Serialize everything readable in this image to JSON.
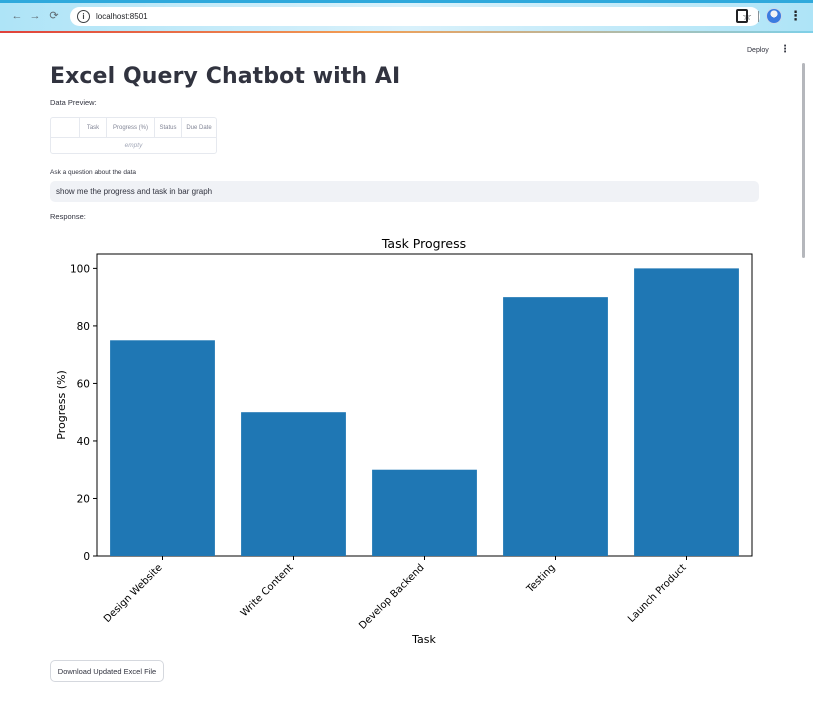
{
  "browser": {
    "url": "localhost:8501",
    "back_glyph": "←",
    "forward_glyph": "→",
    "reload_glyph": "⟳",
    "info_glyph": "i",
    "star_glyph": "☆",
    "menu_glyph": "⋮"
  },
  "header": {
    "deploy_label": "Deploy",
    "menu_glyph": "⋮"
  },
  "main": {
    "title": "Excel Query Chatbot with AI",
    "data_preview_label": "Data Preview:",
    "table": {
      "columns": [
        "",
        "Task",
        "Progress (%)",
        "Status",
        "Due Date"
      ],
      "empty_text": "empty"
    },
    "question_label": "Ask a question about the data",
    "question_value": "show me the progress and task in bar graph",
    "response_label": "Response:",
    "download_label": "Download Updated Excel File"
  },
  "colors": {
    "bar": "#1f77b4",
    "title_text": "#31333f"
  },
  "chart_data": {
    "type": "bar",
    "title": "Task Progress",
    "xlabel": "Task",
    "ylabel": "Progress (%)",
    "categories": [
      "Design Website",
      "Write Content",
      "Develop Backend",
      "Testing",
      "Launch Product"
    ],
    "values": [
      75,
      50,
      30,
      90,
      100
    ],
    "ylim": [
      0,
      105
    ],
    "yticks": [
      0,
      20,
      40,
      60,
      80,
      100
    ],
    "grid": false,
    "legend": "none"
  }
}
